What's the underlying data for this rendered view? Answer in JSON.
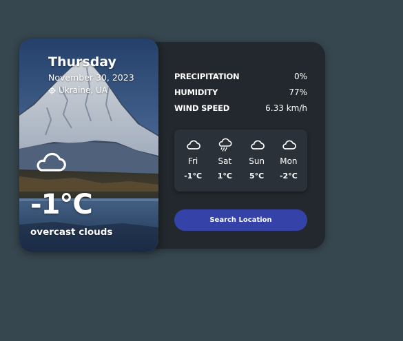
{
  "current": {
    "day": "Thursday",
    "date": "November 30, 2023",
    "location": "Ukraine, UA",
    "temperature": "-1°C",
    "description": "overcast clouds",
    "icon": "cloud-icon"
  },
  "stats": [
    {
      "label": "PRECIPITATION",
      "value": "0%"
    },
    {
      "label": "HUMIDITY",
      "value": "77%"
    },
    {
      "label": "WIND SPEED",
      "value": "6.33 km/h"
    }
  ],
  "forecast": [
    {
      "day": "Fri",
      "temp": "-1°C",
      "icon": "cloud-icon"
    },
    {
      "day": "Sat",
      "temp": "1°C",
      "icon": "rain-cloud-icon"
    },
    {
      "day": "Sun",
      "temp": "5°C",
      "icon": "cloud-icon"
    },
    {
      "day": "Mon",
      "temp": "-2°C",
      "icon": "cloud-icon"
    }
  ],
  "search_button": "Search Location",
  "colors": {
    "background": "#37474f",
    "panel": "#23282e",
    "forecast_box": "#2b3138",
    "button": "#3543a8"
  }
}
